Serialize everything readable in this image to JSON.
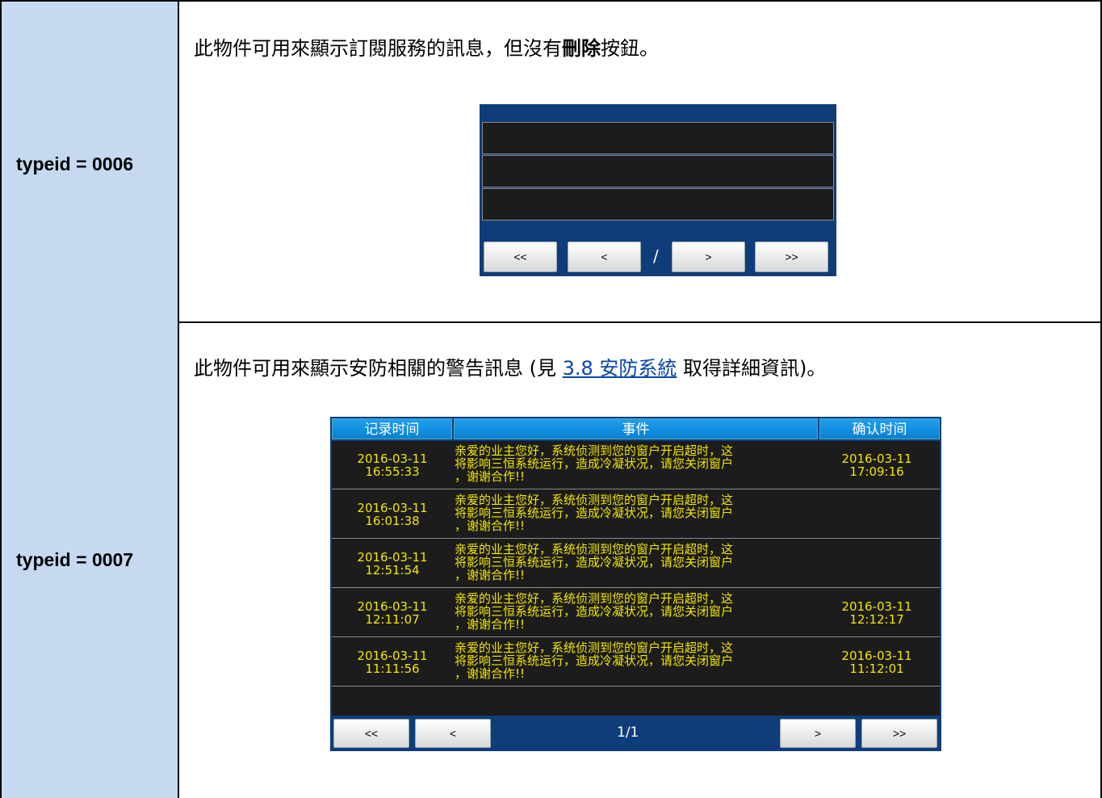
{
  "rows": [
    {
      "typeid_label": "typeid = 0006",
      "description_prefix": "此物件可用來顯示訂閱服務的訊息，但沒有",
      "description_bold": "刪除",
      "description_suffix": "按鈕。",
      "widget": {
        "buttons": {
          "first": "<<",
          "prev": "<",
          "next": ">",
          "last": ">>"
        },
        "page_indicator": "/"
      }
    },
    {
      "typeid_label": "typeid = 0007",
      "description_prefix": "此物件可用來顯示安防相關的警告訊息 (見 ",
      "description_link": "3.8 安防系統",
      "description_suffix": " 取得詳細資訊)。",
      "widget": {
        "columns": [
          "记录时间",
          "事件",
          "确认时间"
        ],
        "rows": [
          {
            "record_date": "2016-03-11",
            "record_time": "16:55:33",
            "event": "亲爱的业主您好，系统侦测到您的窗户开启超时，这\n将影响三恒系统运行，造成冷凝状况，请您关闭窗户\n，谢谢合作!!",
            "confirm_date": "2016-03-11",
            "confirm_time": "17:09:16"
          },
          {
            "record_date": "2016-03-11",
            "record_time": "16:01:38",
            "event": "亲爱的业主您好，系统侦测到您的窗户开启超时，这\n将影响三恒系统运行，造成冷凝状况，请您关闭窗户\n，谢谢合作!!",
            "confirm_date": "",
            "confirm_time": ""
          },
          {
            "record_date": "2016-03-11",
            "record_time": "12:51:54",
            "event": "亲爱的业主您好，系统侦测到您的窗户开启超时，这\n将影响三恒系统运行，造成冷凝状况，请您关闭窗户\n，谢谢合作!!",
            "confirm_date": "",
            "confirm_time": ""
          },
          {
            "record_date": "2016-03-11",
            "record_time": "12:11:07",
            "event": "亲爱的业主您好，系统侦测到您的窗户开启超时，这\n将影响三恒系统运行，造成冷凝状况，请您关闭窗户\n，谢谢合作!!",
            "confirm_date": "2016-03-11",
            "confirm_time": "12:12:17"
          },
          {
            "record_date": "2016-03-11",
            "record_time": "11:11:56",
            "event": "亲爱的业主您好，系统侦测到您的窗户开启超时，这\n将影响三恒系统运行，造成冷凝状况，请您关闭窗户\n，谢谢合作!!",
            "confirm_date": "2016-03-11",
            "confirm_time": "11:12:01"
          }
        ],
        "buttons": {
          "first": "<<",
          "prev": "<",
          "next": ">",
          "last": ">>"
        },
        "page_indicator": "1/1"
      }
    }
  ],
  "colors": {
    "label_bg": "#c6d9f1",
    "widget_bg": "#0f3d7a",
    "event_text": "#f2e600",
    "header_bg": "#0a7fd0"
  }
}
